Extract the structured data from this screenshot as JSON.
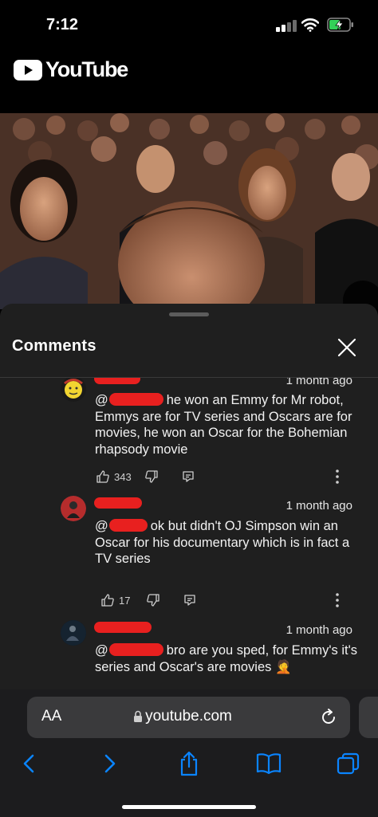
{
  "status_bar": {
    "time": "7:12"
  },
  "youtube": {
    "logo_text": "YouTube"
  },
  "comments_panel": {
    "title": "Comments",
    "comments": [
      {
        "time": "1 month ago",
        "text_prefix": "@",
        "text": "he won an Emmy for Mr robot, Emmys are for TV series and Oscars are for movies, he won an Oscar for the Bohemian rhapsody movie",
        "likes": "343"
      },
      {
        "time": "1 month ago",
        "text_prefix": "@",
        "text": "ok but didn't OJ Simpson win an Oscar for his documentary which is in fact a TV series",
        "likes": "17"
      },
      {
        "time": "1 month ago",
        "text_prefix": "@",
        "text": "bro are you sped, for Emmy's it's series and Oscar's are movies 🤦",
        "likes": ""
      }
    ]
  },
  "browser": {
    "text_size_label": "AA",
    "url": "youtube.com"
  },
  "colors": {
    "sheet_bg": "#1f1f1f",
    "redaction": "#e8201f",
    "accent_blue": "#0a84ff",
    "youtube_red": "#ff0000"
  }
}
